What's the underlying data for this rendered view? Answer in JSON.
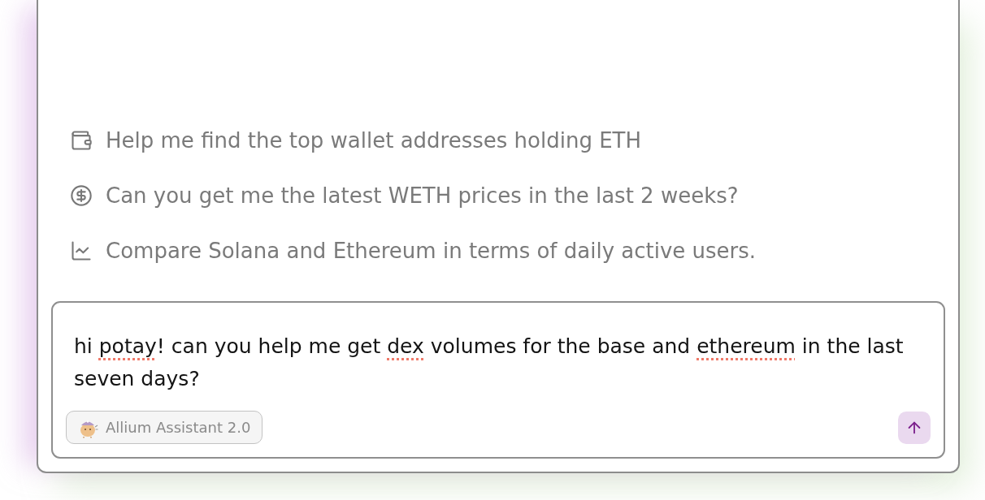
{
  "suggestions": [
    {
      "kind": "wallet",
      "text": "Help me find the top wallet addresses holding ETH"
    },
    {
      "kind": "price",
      "text": "Can you get me the latest WETH prices in the last 2 weeks?"
    },
    {
      "kind": "chart",
      "text": "Compare Solana and Ethereum in terms of daily active users."
    }
  ],
  "composer": {
    "message": [
      {
        "text": "hi ",
        "misspelled": false
      },
      {
        "text": "potay",
        "misspelled": true
      },
      {
        "text": "! can you help me get ",
        "misspelled": false
      },
      {
        "text": "dex",
        "misspelled": true
      },
      {
        "text": " volumes for the base and ",
        "misspelled": false
      },
      {
        "text": "ethereum",
        "misspelled": true
      },
      {
        "text": " in the last seven days?",
        "misspelled": false
      }
    ],
    "model": "Allium Assistant 2.0"
  }
}
